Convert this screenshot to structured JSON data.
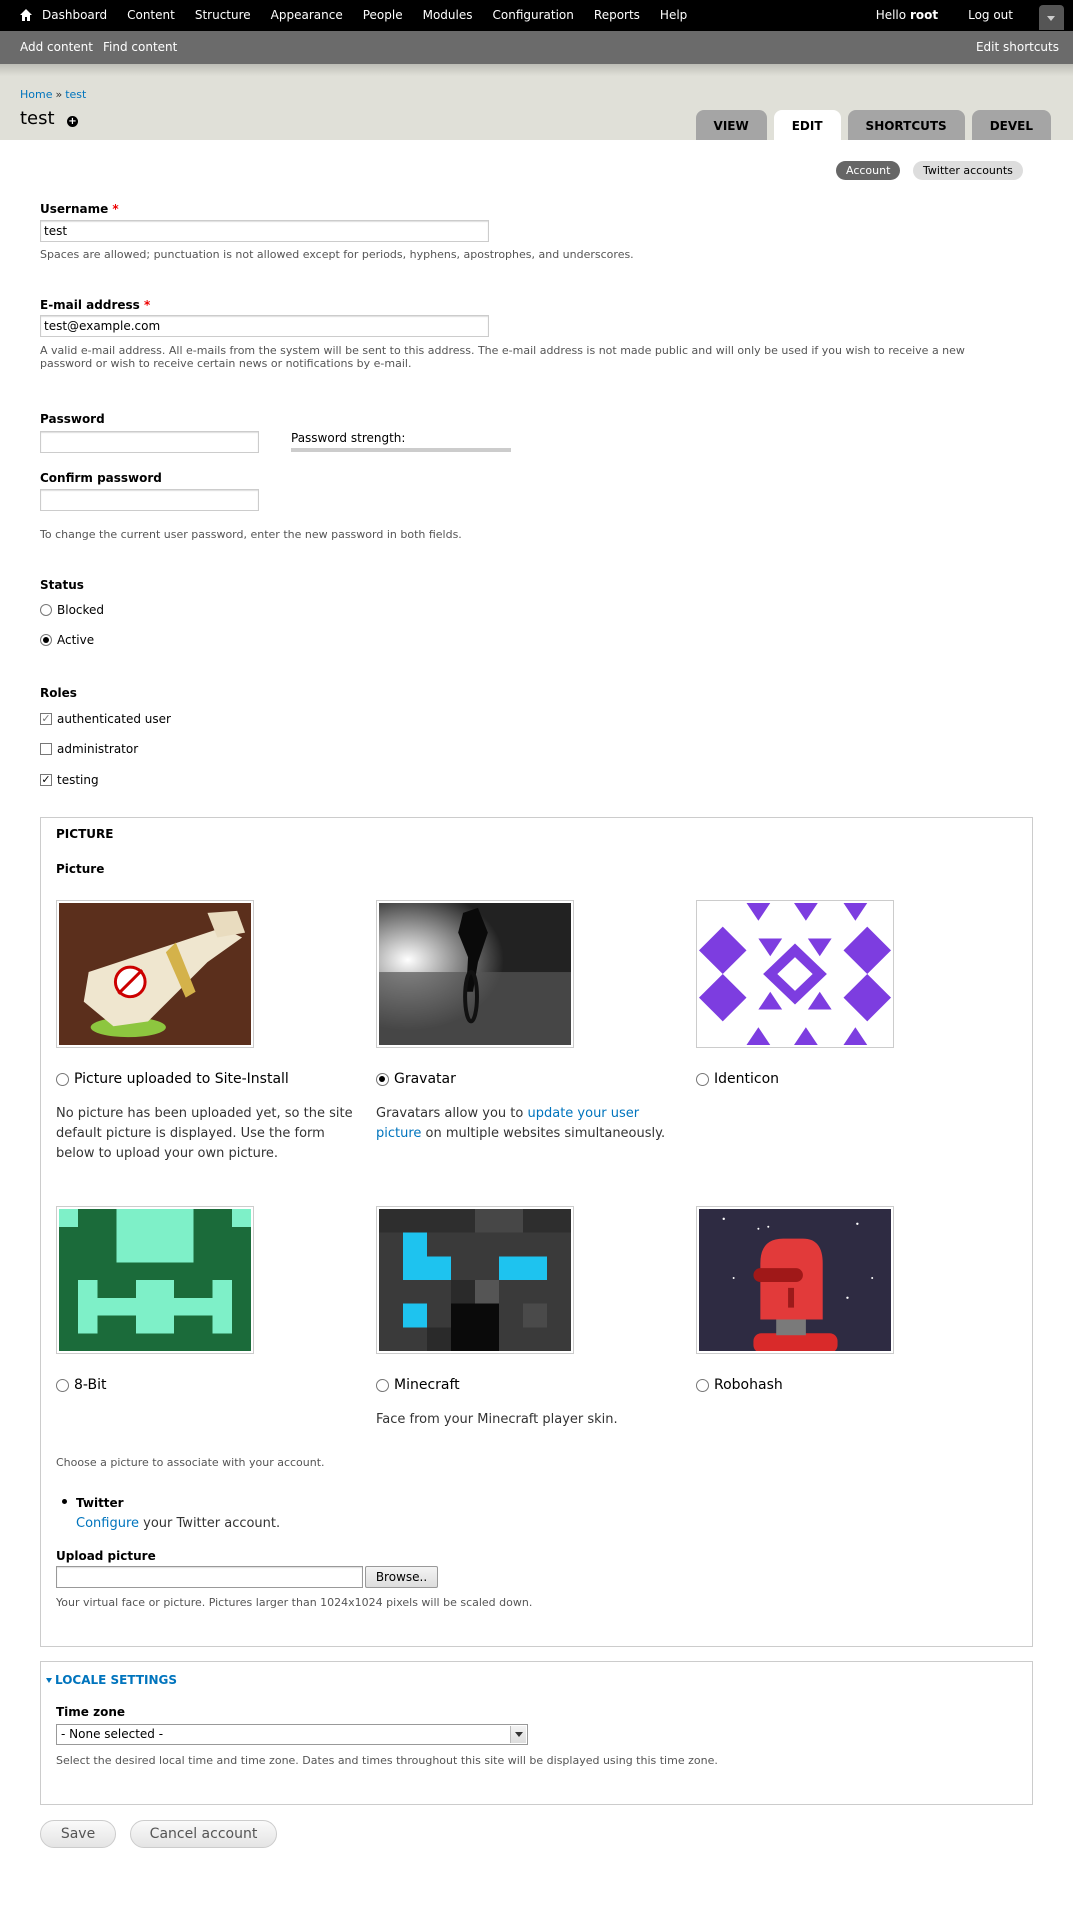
{
  "toolbar": {
    "menu": [
      "Dashboard",
      "Content",
      "Structure",
      "Appearance",
      "People",
      "Modules",
      "Configuration",
      "Reports",
      "Help"
    ],
    "hello": "Hello",
    "username": "root",
    "logout": "Log out"
  },
  "shortcuts": {
    "add_content": "Add content",
    "find_content": "Find content",
    "edit_shortcuts": "Edit shortcuts"
  },
  "breadcrumb": {
    "home": "Home",
    "sep": "»",
    "current": "test"
  },
  "page_title": "test",
  "tabs": [
    "VIEW",
    "EDIT",
    "SHORTCUTS",
    "DEVEL"
  ],
  "secondary_tabs": {
    "account": "Account",
    "twitter": "Twitter accounts"
  },
  "username": {
    "label": "Username",
    "required": "*",
    "value": "test",
    "desc": "Spaces are allowed; punctuation is not allowed except for periods, hyphens, apostrophes, and underscores."
  },
  "email": {
    "label": "E-mail address",
    "required": "*",
    "value": "test@example.com",
    "desc1": "A valid e-mail address. All e-mails from the system will be sent to this address. The e-mail address is not made public and will only be used if you wish to receive a new",
    "desc2": "password or wish to receive certain news or notifications by e-mail."
  },
  "password": {
    "label": "Password",
    "strength_label": "Password strength:",
    "confirm_label": "Confirm password",
    "desc": "To change the current user password, enter the new password in both fields."
  },
  "status": {
    "label": "Status",
    "blocked": "Blocked",
    "active": "Active",
    "selected": "Active"
  },
  "roles": {
    "label": "Roles",
    "items": [
      {
        "name": "authenticated user",
        "checked": true
      },
      {
        "name": "administrator",
        "checked": false
      },
      {
        "name": "testing",
        "checked": true
      }
    ]
  },
  "picture": {
    "legend": "PICTURE",
    "sub_label": "Picture",
    "options": {
      "uploaded": "Picture uploaded to Site-Install",
      "gravatar": "Gravatar",
      "identicon": "Identicon",
      "eightbit": "8-Bit",
      "minecraft": "Minecraft",
      "robohash": "Robohash"
    },
    "selected": "Gravatar",
    "uploaded_desc": [
      "No picture has been uploaded yet, so the site",
      "default picture is displayed. Use the form",
      "below to upload your own picture."
    ],
    "gravatar_desc": {
      "before": "Gravatars allow you to",
      "link1": "update your user",
      "link2": "picture",
      "after": "on multiple websites simultaneously."
    },
    "minecraft_desc": "Face from your Minecraft player skin.",
    "choose_desc": "Choose a picture to associate with your account.",
    "twitter_title": "Twitter",
    "twitter_link": "Configure",
    "twitter_after": "your Twitter account.",
    "upload_label": "Upload picture",
    "browse": "Browse..",
    "upload_desc": "Your virtual face or picture. Pictures larger than 1024x1024 pixels will be scaled down."
  },
  "locale": {
    "legend": "LOCALE SETTINGS",
    "timezone_label": "Time zone",
    "timezone_value": "- None selected -",
    "desc": "Select the desired local time and time zone. Dates and times throughout this site will be displayed using this time zone."
  },
  "actions": {
    "save": "Save",
    "cancel": "Cancel account"
  }
}
